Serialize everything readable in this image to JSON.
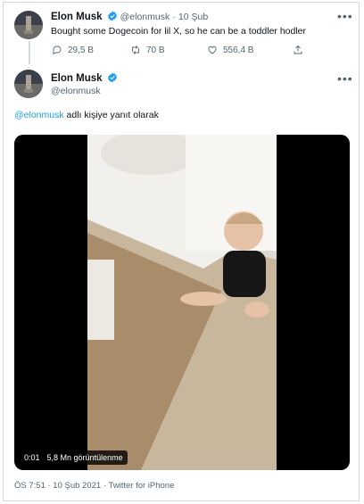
{
  "quoted_tweet": {
    "author_name": "Elon Musk",
    "handle": "@elonmusk",
    "separator": "·",
    "date": "10 Şub",
    "text": "Bought some Dogecoin for lil X, so he can be a toddler hodler",
    "replies": "29,5 B",
    "retweets": "70 B",
    "likes": "556,4 B",
    "icons": [
      "more-icon",
      "reply-icon",
      "retweet-icon",
      "like-icon",
      "share-icon",
      "verified-icon"
    ]
  },
  "main_tweet": {
    "author_name": "Elon Musk",
    "handle": "@elonmusk",
    "reply_to_handle": "@elonmusk",
    "reply_to_suffix": "adlı kişiye yanıt olarak",
    "video": {
      "time": "0:01",
      "views": "5,8 Mn görüntülenme"
    },
    "timestamp": "ÖS 7:51 · 10 Şub 2021 · Twitter for iPhone"
  },
  "colors": {
    "accent": "#1d9bf0",
    "text": "#0f1419",
    "muted": "#536471",
    "border": "#cfd9de"
  }
}
